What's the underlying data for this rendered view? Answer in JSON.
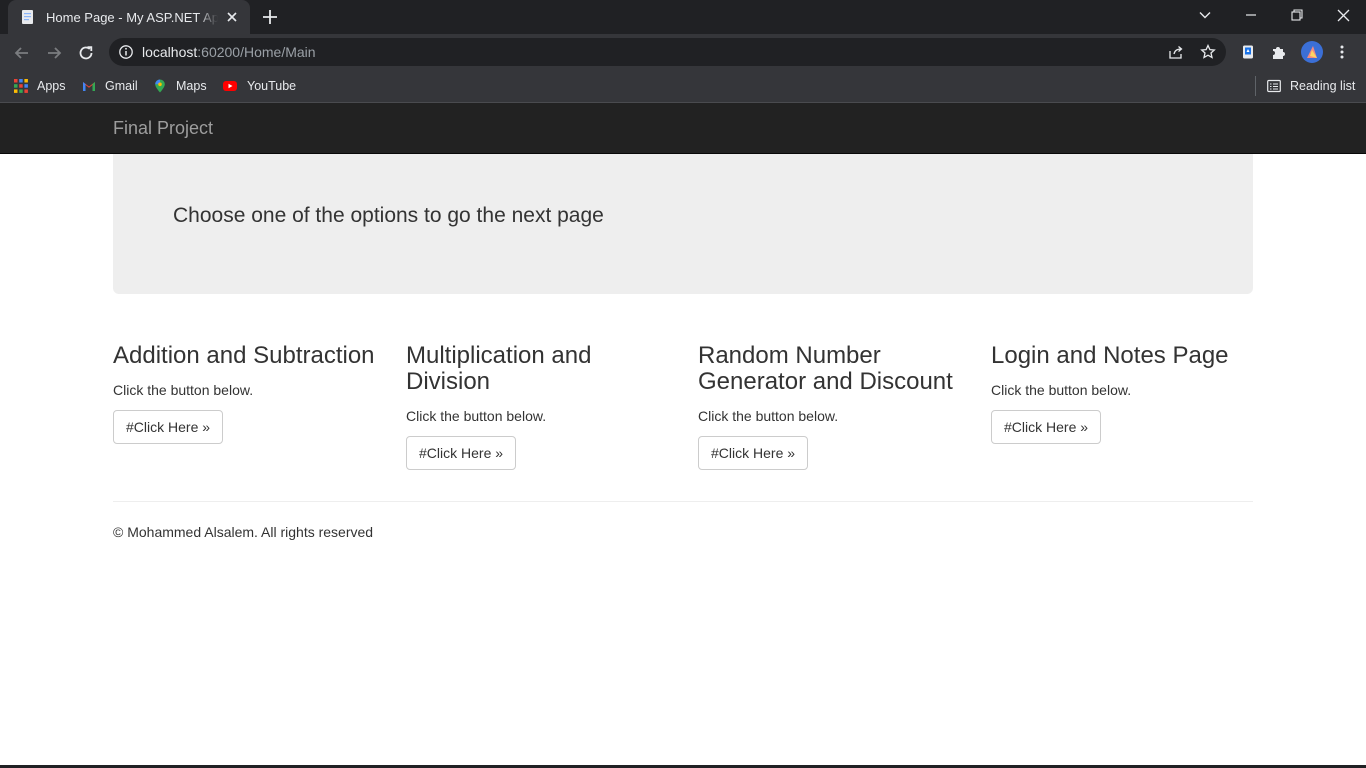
{
  "browser": {
    "tab_title": "Home Page - My ASP.NET Application",
    "url_host": "localhost",
    "url_path": ":60200/Home/Main",
    "bookmarks": [
      {
        "label": "Apps",
        "icon": "apps-grid-icon"
      },
      {
        "label": "Gmail",
        "icon": "gmail-icon"
      },
      {
        "label": "Maps",
        "icon": "maps-icon"
      },
      {
        "label": "YouTube",
        "icon": "youtube-icon"
      }
    ],
    "reading_list": "Reading list"
  },
  "navbar": {
    "brand": "Final Project"
  },
  "jumbotron": {
    "text": "Choose one of the options to go the next page"
  },
  "sections": [
    {
      "title": "Addition and Subtraction",
      "description": "Click the button below.",
      "button": "#Click Here »"
    },
    {
      "title": "Multiplication and Division",
      "description": "Click the button below.",
      "button": "#Click Here »"
    },
    {
      "title": "Random Number Generator and Discount",
      "description": "Click the button below.",
      "button": "#Click Here »"
    },
    {
      "title": "Login and Notes Page",
      "description": "Click the button below.",
      "button": "#Click Here »"
    }
  ],
  "footer": {
    "text": "© Mohammed Alsalem. All rights reserved"
  },
  "colors": {
    "navbar_bg": "#222222",
    "brand_text": "#9d9d9d",
    "jumbotron_bg": "#eeeeee",
    "body_text": "#333333"
  }
}
